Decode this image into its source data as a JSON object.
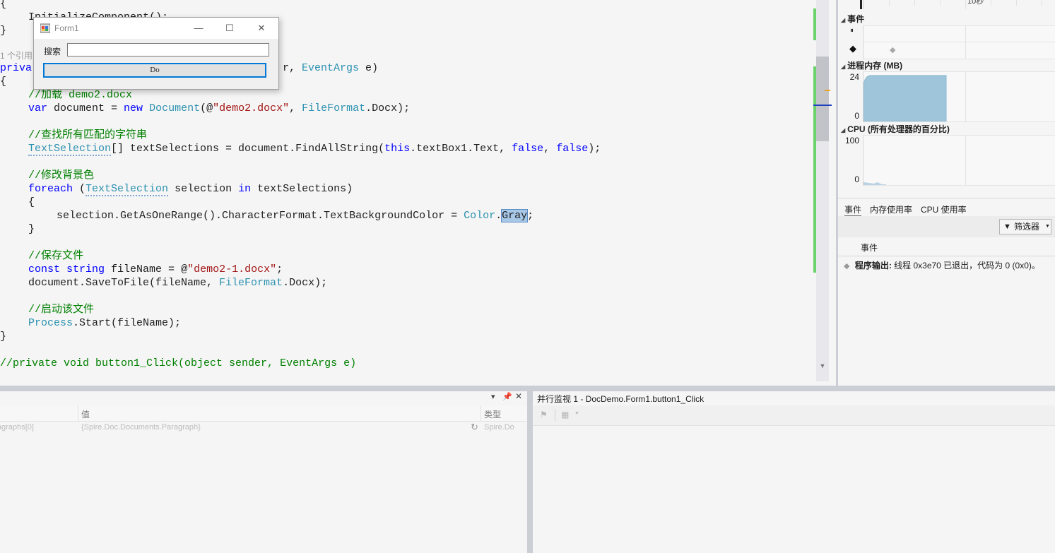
{
  "editor": {
    "lines": {
      "l0_brace": "{",
      "l1_call": "InitializeComponent();",
      "l2_brace": "}",
      "l3_ref": "1 个引用",
      "l4_kw": "priva",
      "l4_rest": "r, ",
      "l4_type": "EventArgs",
      "l4_end": " e)",
      "l5_brace": "{",
      "c1": "//加载 demo2.docx",
      "var_kw": "var",
      "var_mid": " document = ",
      "new_kw": "new",
      "doc_type": "Document",
      "doc_open": "(@",
      "doc_str": "\"demo2.docx\"",
      "doc_comma": ", ",
      "ff_type": "FileFormat",
      "doc_end": ".Docx);",
      "c2": "//查找所有匹配的字符串",
      "ts_type": "TextSelection",
      "ts_mid": "[] textSelections = document.FindAllString(",
      "this_kw": "this",
      "ts_mid2": ".textBox1.Text, ",
      "false1": "false",
      "ts_comma": ", ",
      "false2": "false",
      "ts_end": ");",
      "c3": "//修改背景色",
      "foreach_kw": "foreach",
      "fe_open": " (",
      "fe_type": "TextSelection",
      "fe_mid": " selection ",
      "in_kw": "in",
      "fe_end": " textSelections)",
      "inner_open": "{",
      "sel_code": "selection.GetAsOneRange().CharacterFormat.TextBackgroundColor = ",
      "color_type": "Color",
      "dot": ".",
      "gray": "Gray",
      "semi": ";",
      "inner_close": "}",
      "c4": "//保存文件",
      "const_kw": "const",
      "space": " ",
      "string_kw": "string",
      "fn_mid": " fileName = @",
      "fn_str": "\"demo2-1.docx\"",
      "fn_end": ";",
      "save_code": "document.SaveToFile(fileName, ",
      "save_type": "FileFormat",
      "save_end": ".Docx);",
      "c5": "//启动该文件",
      "proc_type": "Process",
      "proc_end": ".Start(fileName);",
      "close_brace": "}",
      "c6": "//private void button1_Click(object sender, EventArgs e)"
    }
  },
  "form1": {
    "title": "Form1",
    "minimize": "—",
    "maximize": "☐",
    "close": "✕",
    "search_label": "搜索",
    "search_value": "",
    "do_button": "Do"
  },
  "diag": {
    "timeline_label": "10秒",
    "events_title": "事件",
    "pause_glyph": "⏸",
    "memory_title": "进程内存 (MB)",
    "memory_max": "24",
    "memory_min": "0",
    "cpu_title": "CPU (所有处理器的百分比)",
    "cpu_max": "100",
    "cpu_min": "0",
    "tabs": [
      "事件",
      "内存使用率",
      "CPU 使用率"
    ],
    "filter_label": "筛选器",
    "events_column": "事件",
    "event_row_bold": "程序输出:",
    "event_row_text": " 线程 0x3e70 已退出，代码为 0 (0x0)。",
    "memory_fill_fraction": 0.93
  },
  "watch": {
    "col_name": "",
    "col_value": "值",
    "col_type": "类型",
    "row_name": "agraphs[0]",
    "row_value": "{Spire.Doc.Documents.Paragraph}",
    "row_type": "Spire.Do"
  },
  "parallel": {
    "title": "并行监视 1 - DocDemo.Form1.button1_Click"
  }
}
